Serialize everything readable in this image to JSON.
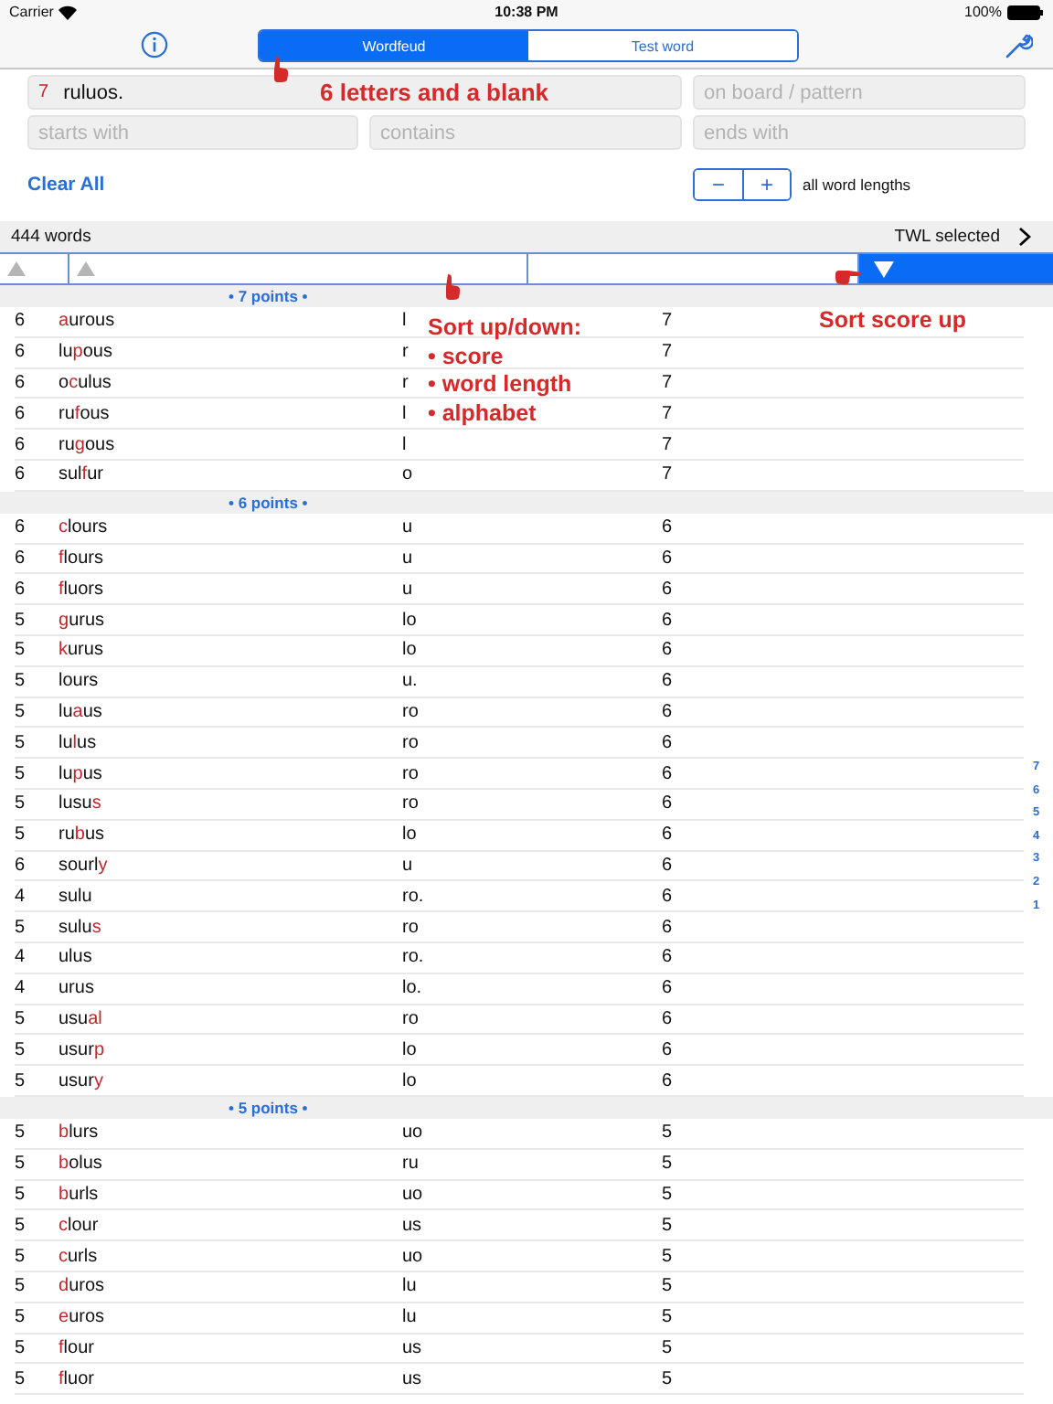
{
  "status_bar": {
    "carrier": "Carrier",
    "time": "10:38 PM",
    "battery": "100%"
  },
  "tabs": [
    {
      "label": "Wordfeud",
      "selected": true
    },
    {
      "label": "Test word",
      "selected": false
    }
  ],
  "rack": {
    "count": "7",
    "value": "ruluos."
  },
  "pattern_field": {
    "placeholder": "on board / pattern"
  },
  "filters": [
    {
      "placeholder": "starts with"
    },
    {
      "placeholder": "contains"
    },
    {
      "placeholder": "ends with"
    }
  ],
  "clear_button": "Clear All",
  "stepper": {
    "minus": "−",
    "plus": "+",
    "label": "all word lengths"
  },
  "summary": {
    "count": "444 words",
    "dictionary": "TWL selected"
  },
  "sort_columns": [
    {
      "selected": false,
      "descending": false
    },
    {
      "selected": false,
      "descending": false
    },
    {
      "selected": false
    },
    {
      "selected": true,
      "descending": true
    }
  ],
  "sections": [
    {
      "title": "• 7 points •",
      "rows": [
        {
          "length": "6",
          "word": [
            {
              "text": "a",
              "blank": true
            },
            {
              "text": "urous",
              "blank": false
            }
          ],
          "leftover": "l",
          "score": "7"
        },
        {
          "length": "6",
          "word": [
            {
              "text": "lu",
              "blank": false
            },
            {
              "text": "p",
              "blank": true
            },
            {
              "text": "ous",
              "blank": false
            }
          ],
          "leftover": "r",
          "score": "7"
        },
        {
          "length": "6",
          "word": [
            {
              "text": "o",
              "blank": false
            },
            {
              "text": "c",
              "blank": true
            },
            {
              "text": "ulus",
              "blank": false
            }
          ],
          "leftover": "r",
          "score": "7"
        },
        {
          "length": "6",
          "word": [
            {
              "text": "ru",
              "blank": false
            },
            {
              "text": "f",
              "blank": true
            },
            {
              "text": "ous",
              "blank": false
            }
          ],
          "leftover": "l",
          "score": "7"
        },
        {
          "length": "6",
          "word": [
            {
              "text": "ru",
              "blank": false
            },
            {
              "text": "g",
              "blank": true
            },
            {
              "text": "ous",
              "blank": false
            }
          ],
          "leftover": "l",
          "score": "7"
        },
        {
          "length": "6",
          "word": [
            {
              "text": "sul",
              "blank": false
            },
            {
              "text": "f",
              "blank": true
            },
            {
              "text": "ur",
              "blank": false
            }
          ],
          "leftover": "o",
          "score": "7"
        }
      ]
    },
    {
      "title": "• 6 points •",
      "rows": [
        {
          "length": "6",
          "word": [
            {
              "text": "c",
              "blank": true
            },
            {
              "text": "lours",
              "blank": false
            }
          ],
          "leftover": "u",
          "score": "6"
        },
        {
          "length": "6",
          "word": [
            {
              "text": "f",
              "blank": true
            },
            {
              "text": "lours",
              "blank": false
            }
          ],
          "leftover": "u",
          "score": "6"
        },
        {
          "length": "6",
          "word": [
            {
              "text": "f",
              "blank": true
            },
            {
              "text": "luors",
              "blank": false
            }
          ],
          "leftover": "u",
          "score": "6"
        },
        {
          "length": "5",
          "word": [
            {
              "text": "g",
              "blank": true
            },
            {
              "text": "urus",
              "blank": false
            }
          ],
          "leftover": "lo",
          "score": "6"
        },
        {
          "length": "5",
          "word": [
            {
              "text": "k",
              "blank": true
            },
            {
              "text": "urus",
              "blank": false
            }
          ],
          "leftover": "lo",
          "score": "6"
        },
        {
          "length": "5",
          "word": [
            {
              "text": "lours",
              "blank": false
            }
          ],
          "leftover": "u.",
          "score": "6"
        },
        {
          "length": "5",
          "word": [
            {
              "text": "lu",
              "blank": false
            },
            {
              "text": "a",
              "blank": true
            },
            {
              "text": "us",
              "blank": false
            }
          ],
          "leftover": "ro",
          "score": "6"
        },
        {
          "length": "5",
          "word": [
            {
              "text": "lu",
              "blank": false
            },
            {
              "text": "l",
              "blank": true
            },
            {
              "text": "us",
              "blank": false
            }
          ],
          "leftover": "ro",
          "score": "6"
        },
        {
          "length": "5",
          "word": [
            {
              "text": "lu",
              "blank": false
            },
            {
              "text": "p",
              "blank": true
            },
            {
              "text": "us",
              "blank": false
            }
          ],
          "leftover": "ro",
          "score": "6"
        },
        {
          "length": "5",
          "word": [
            {
              "text": "lusu",
              "blank": false
            },
            {
              "text": "s",
              "blank": true
            }
          ],
          "leftover": "ro",
          "score": "6"
        },
        {
          "length": "5",
          "word": [
            {
              "text": "ru",
              "blank": false
            },
            {
              "text": "b",
              "blank": true
            },
            {
              "text": "us",
              "blank": false
            }
          ],
          "leftover": "lo",
          "score": "6"
        },
        {
          "length": "6",
          "word": [
            {
              "text": "sourl",
              "blank": false
            },
            {
              "text": "y",
              "blank": true
            }
          ],
          "leftover": "u",
          "score": "6"
        },
        {
          "length": "4",
          "word": [
            {
              "text": "sulu",
              "blank": false
            }
          ],
          "leftover": "ro.",
          "score": "6"
        },
        {
          "length": "5",
          "word": [
            {
              "text": "sulu",
              "blank": false
            },
            {
              "text": "s",
              "blank": true
            }
          ],
          "leftover": "ro",
          "score": "6"
        },
        {
          "length": "4",
          "word": [
            {
              "text": "ulus",
              "blank": false
            }
          ],
          "leftover": "ro.",
          "score": "6"
        },
        {
          "length": "4",
          "word": [
            {
              "text": "urus",
              "blank": false
            }
          ],
          "leftover": "lo.",
          "score": "6"
        },
        {
          "length": "5",
          "word": [
            {
              "text": "usu",
              "blank": false
            },
            {
              "text": "al",
              "blank": true
            }
          ],
          "leftover": "ro",
          "score": "6"
        },
        {
          "length": "5",
          "word": [
            {
              "text": "usur",
              "blank": false
            },
            {
              "text": "p",
              "blank": true
            }
          ],
          "leftover": "lo",
          "score": "6"
        },
        {
          "length": "5",
          "word": [
            {
              "text": "usur",
              "blank": false
            },
            {
              "text": "y",
              "blank": true
            }
          ],
          "leftover": "lo",
          "score": "6"
        }
      ]
    },
    {
      "title": "• 5 points •",
      "rows": [
        {
          "length": "5",
          "word": [
            {
              "text": "b",
              "blank": true
            },
            {
              "text": "lurs",
              "blank": false
            }
          ],
          "leftover": "uo",
          "score": "5"
        },
        {
          "length": "5",
          "word": [
            {
              "text": "b",
              "blank": true
            },
            {
              "text": "olus",
              "blank": false
            }
          ],
          "leftover": "ru",
          "score": "5"
        },
        {
          "length": "5",
          "word": [
            {
              "text": "b",
              "blank": true
            },
            {
              "text": "urls",
              "blank": false
            }
          ],
          "leftover": "uo",
          "score": "5"
        },
        {
          "length": "5",
          "word": [
            {
              "text": "c",
              "blank": true
            },
            {
              "text": "lour",
              "blank": false
            }
          ],
          "leftover": "us",
          "score": "5"
        },
        {
          "length": "5",
          "word": [
            {
              "text": "c",
              "blank": true
            },
            {
              "text": "urls",
              "blank": false
            }
          ],
          "leftover": "uo",
          "score": "5"
        },
        {
          "length": "5",
          "word": [
            {
              "text": "d",
              "blank": true
            },
            {
              "text": "uros",
              "blank": false
            }
          ],
          "leftover": "lu",
          "score": "5"
        },
        {
          "length": "5",
          "word": [
            {
              "text": "e",
              "blank": true
            },
            {
              "text": "uros",
              "blank": false
            }
          ],
          "leftover": "lu",
          "score": "5"
        },
        {
          "length": "5",
          "word": [
            {
              "text": "f",
              "blank": true
            },
            {
              "text": "lour",
              "blank": false
            }
          ],
          "leftover": "us",
          "score": "5"
        },
        {
          "length": "5",
          "word": [
            {
              "text": "f",
              "blank": true
            },
            {
              "text": "luor",
              "blank": false
            }
          ],
          "leftover": "us",
          "score": "5"
        }
      ]
    }
  ],
  "index": [
    "7",
    "6",
    "5",
    "4",
    "3",
    "2",
    "1"
  ],
  "annotations": {
    "rack_hint": "6 letters and a blank",
    "sort_hint": {
      "title": "Sort up/down:",
      "items": [
        "• score",
        "• word length",
        "• alphabet"
      ]
    },
    "score_hint": "Sort score up"
  }
}
